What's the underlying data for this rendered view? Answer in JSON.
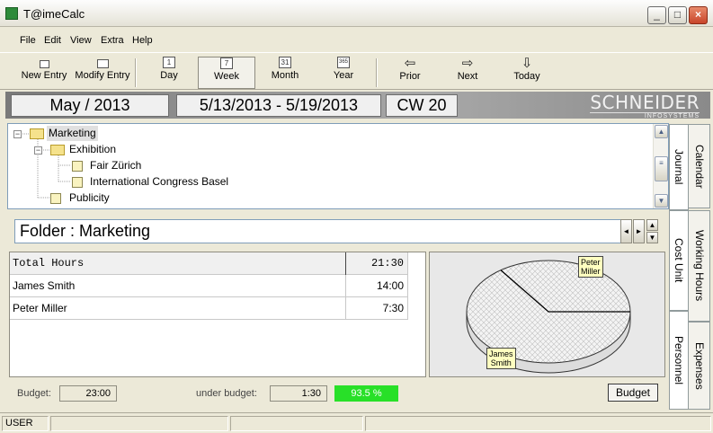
{
  "window": {
    "title": "T@imeCalc"
  },
  "menu": [
    "File",
    "Edit",
    "View",
    "Extra",
    "Help"
  ],
  "toolbar": {
    "new_entry": "New Entry",
    "modify_entry": "Modify Entry",
    "day": "Day",
    "week": "Week",
    "month": "Month",
    "year": "Year",
    "prior": "Prior",
    "next": "Next",
    "today": "Today",
    "day_icon": "1",
    "week_icon": "7",
    "month_icon": "31",
    "year_icon": "365",
    "active_view": "Week"
  },
  "header": {
    "month": "May / 2013",
    "range": "5/13/2013 - 5/19/2013",
    "week": "CW 20",
    "brand": "SCHNEIDER",
    "brand_sub": "INFOSYSTEMS"
  },
  "tree": {
    "root": "Marketing",
    "exhibition": "Exhibition",
    "fair": "Fair Zürich",
    "congress": "International Congress Basel",
    "publicity": "Publicity"
  },
  "tabs": {
    "calendar": "Calendar",
    "journal": "Journal",
    "working_hours": "Working Hours",
    "cost_unit": "Cost Unit",
    "expenses": "Expenses",
    "personnel": "Personnel"
  },
  "folder": {
    "title": "Folder : Marketing"
  },
  "table": {
    "header": {
      "label": "Total Hours",
      "value": "21:30"
    },
    "rows": [
      {
        "name": "James Smith",
        "value": "14:00"
      },
      {
        "name": "Peter Miller",
        "value": "7:30"
      }
    ]
  },
  "pie": {
    "label_peter": "Peter\nMiller",
    "label_james": "James\nSmith",
    "peter_fraction": 0.349,
    "james_fraction": 0.651
  },
  "footer": {
    "budget_label": "Budget:",
    "budget_value": "23:00",
    "under_label": "under budget:",
    "under_value": "1:30",
    "percent": "93.5 %",
    "button": "Budget"
  },
  "status": {
    "user": "USER"
  }
}
